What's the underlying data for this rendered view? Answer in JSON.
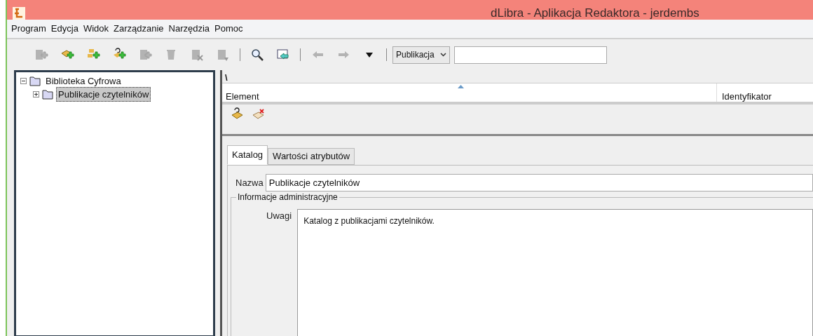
{
  "window": {
    "title": "dLibra - Aplikacja Redaktora - jerdembs"
  },
  "menu": [
    "Program",
    "Edycja",
    "Widok",
    "Zarządzanie",
    "Narzędzia",
    "Pomoc"
  ],
  "toolbar": [
    {
      "kind": "button",
      "disabled": true
    },
    {
      "kind": "button",
      "disabled": false
    },
    {
      "kind": "button",
      "disabled": false
    },
    {
      "kind": "button",
      "disabled": false
    },
    {
      "kind": "button",
      "disabled": true
    },
    {
      "kind": "button",
      "disabled": true
    },
    {
      "kind": "button",
      "disabled": true
    },
    {
      "kind": "button",
      "disabled": true
    },
    {
      "kind": "separator"
    },
    {
      "kind": "button",
      "disabled": false
    },
    {
      "kind": "button",
      "disabled": false
    },
    {
      "kind": "separator"
    },
    {
      "kind": "button",
      "disabled": true
    },
    {
      "kind": "button",
      "disabled": true
    },
    {
      "kind": "button",
      "disabled": false
    },
    {
      "kind": "separator"
    }
  ],
  "search": {
    "scope": "Publikacja"
  },
  "tree": [
    {
      "label": "Biblioteka Cyfrowa",
      "expanded": true,
      "selected": false,
      "children": [
        {
          "label": "Publikacje czytelników",
          "expanded": false,
          "selected": true
        }
      ]
    }
  ],
  "path": "\\",
  "table": {
    "columns": [
      "Element",
      "Identyfikator"
    ]
  },
  "tabs": [
    {
      "label": "Katalog",
      "selected": true
    },
    {
      "label": "Wartości atrybutów",
      "selected": false
    }
  ],
  "form": {
    "name_label": "Nazwa",
    "name_value": "Publikacje czytelników",
    "group_title": "Informacje administracyjne",
    "notes_label": "Uwagi",
    "notes_value": "Katalog z publikacjami czytelników."
  }
}
